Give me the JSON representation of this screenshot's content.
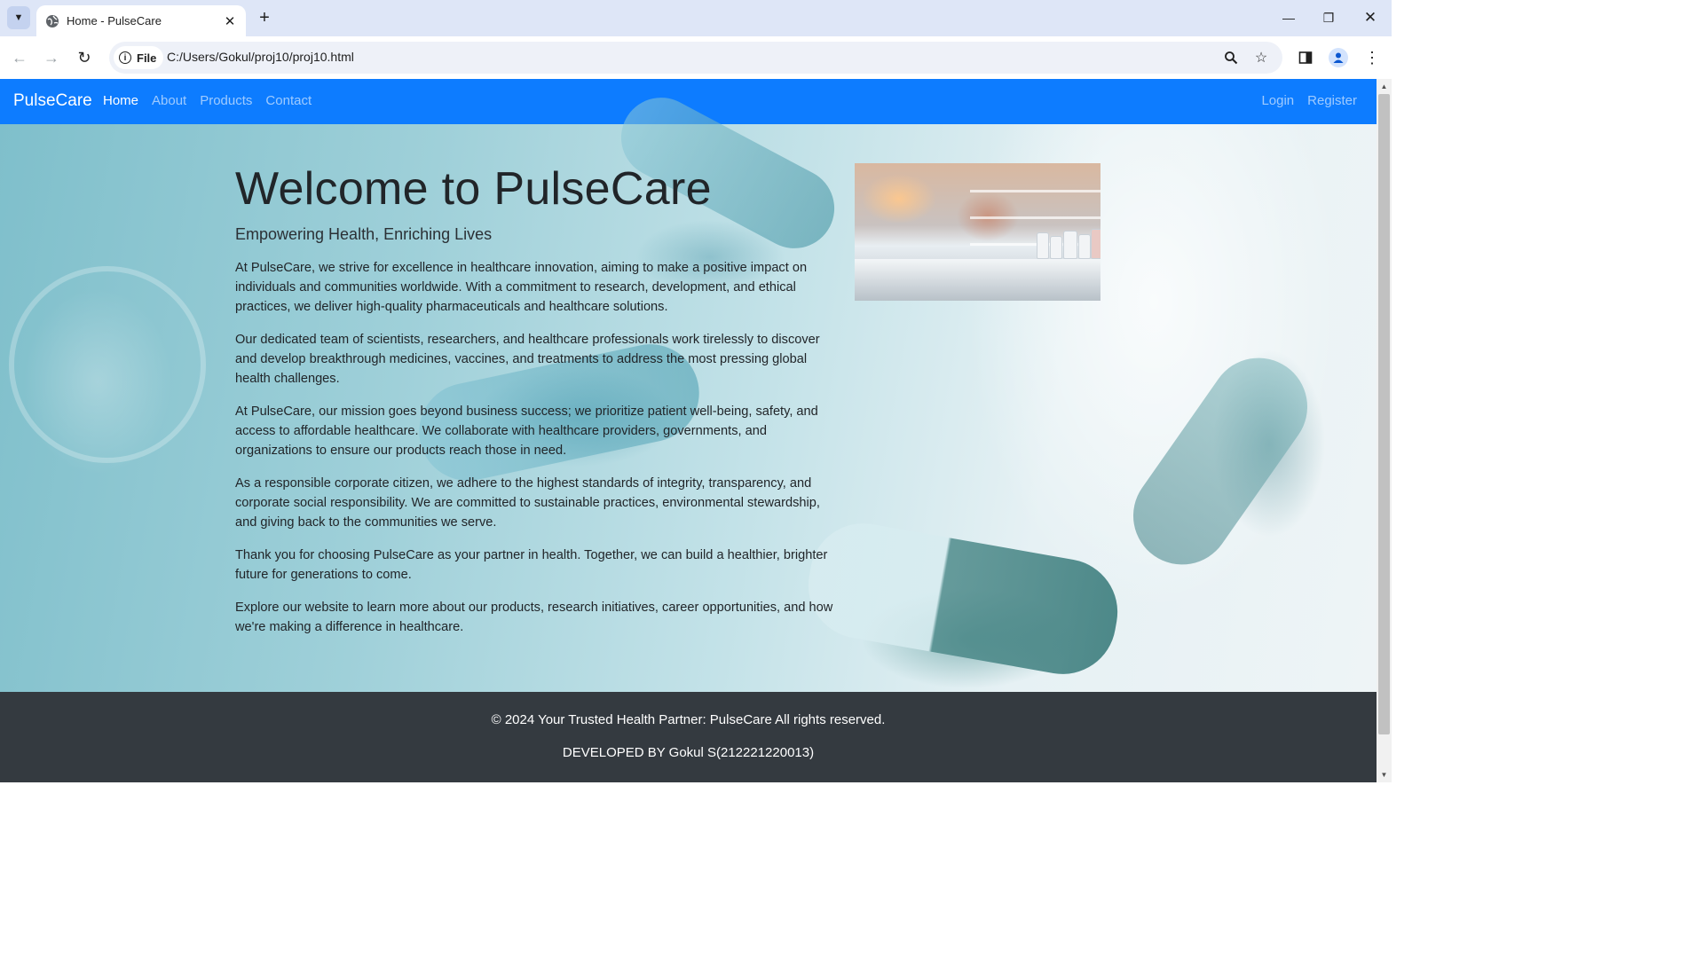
{
  "browser": {
    "tab_title": "Home - PulseCare",
    "site_chip": "File",
    "url": "C:/Users/Gokul/proj10/proj10.html"
  },
  "navbar": {
    "brand": "PulseCare",
    "links": [
      {
        "label": "Home",
        "active": true
      },
      {
        "label": "About",
        "active": false
      },
      {
        "label": "Products",
        "active": false
      },
      {
        "label": "Contact",
        "active": false
      }
    ],
    "right": [
      {
        "label": "Login"
      },
      {
        "label": "Register"
      }
    ]
  },
  "hero": {
    "title": "Welcome to PulseCare",
    "subtitle": "Empowering Health, Enriching Lives",
    "paragraphs": [
      "At PulseCare, we strive for excellence in healthcare innovation, aiming to make a positive impact on individuals and communities worldwide. With a commitment to research, development, and ethical practices, we deliver high-quality pharmaceuticals and healthcare solutions.",
      "Our dedicated team of scientists, researchers, and healthcare professionals work tirelessly to discover and develop breakthrough medicines, vaccines, and treatments to address the most pressing global health challenges.",
      "At PulseCare, our mission goes beyond business success; we prioritize patient well-being, safety, and access to affordable healthcare. We collaborate with healthcare providers, governments, and organizations to ensure our products reach those in need.",
      "As a responsible corporate citizen, we adhere to the highest standards of integrity, transparency, and corporate social responsibility. We are committed to sustainable practices, environmental stewardship, and giving back to the communities we serve.",
      "Thank you for choosing PulseCare as your partner in health. Together, we can build a healthier, brighter future for generations to come.",
      "Explore our website to learn more about our products, research initiatives, career opportunities, and how we're making a difference in healthcare."
    ]
  },
  "footer": {
    "copyright": "© 2024 Your Trusted Health Partner: PulseCare All rights reserved.",
    "developer": "DEVELOPED BY Gokul S(212221220013)"
  },
  "colors": {
    "navbar_bg": "#0d7cff",
    "footer_bg": "#343a40"
  }
}
